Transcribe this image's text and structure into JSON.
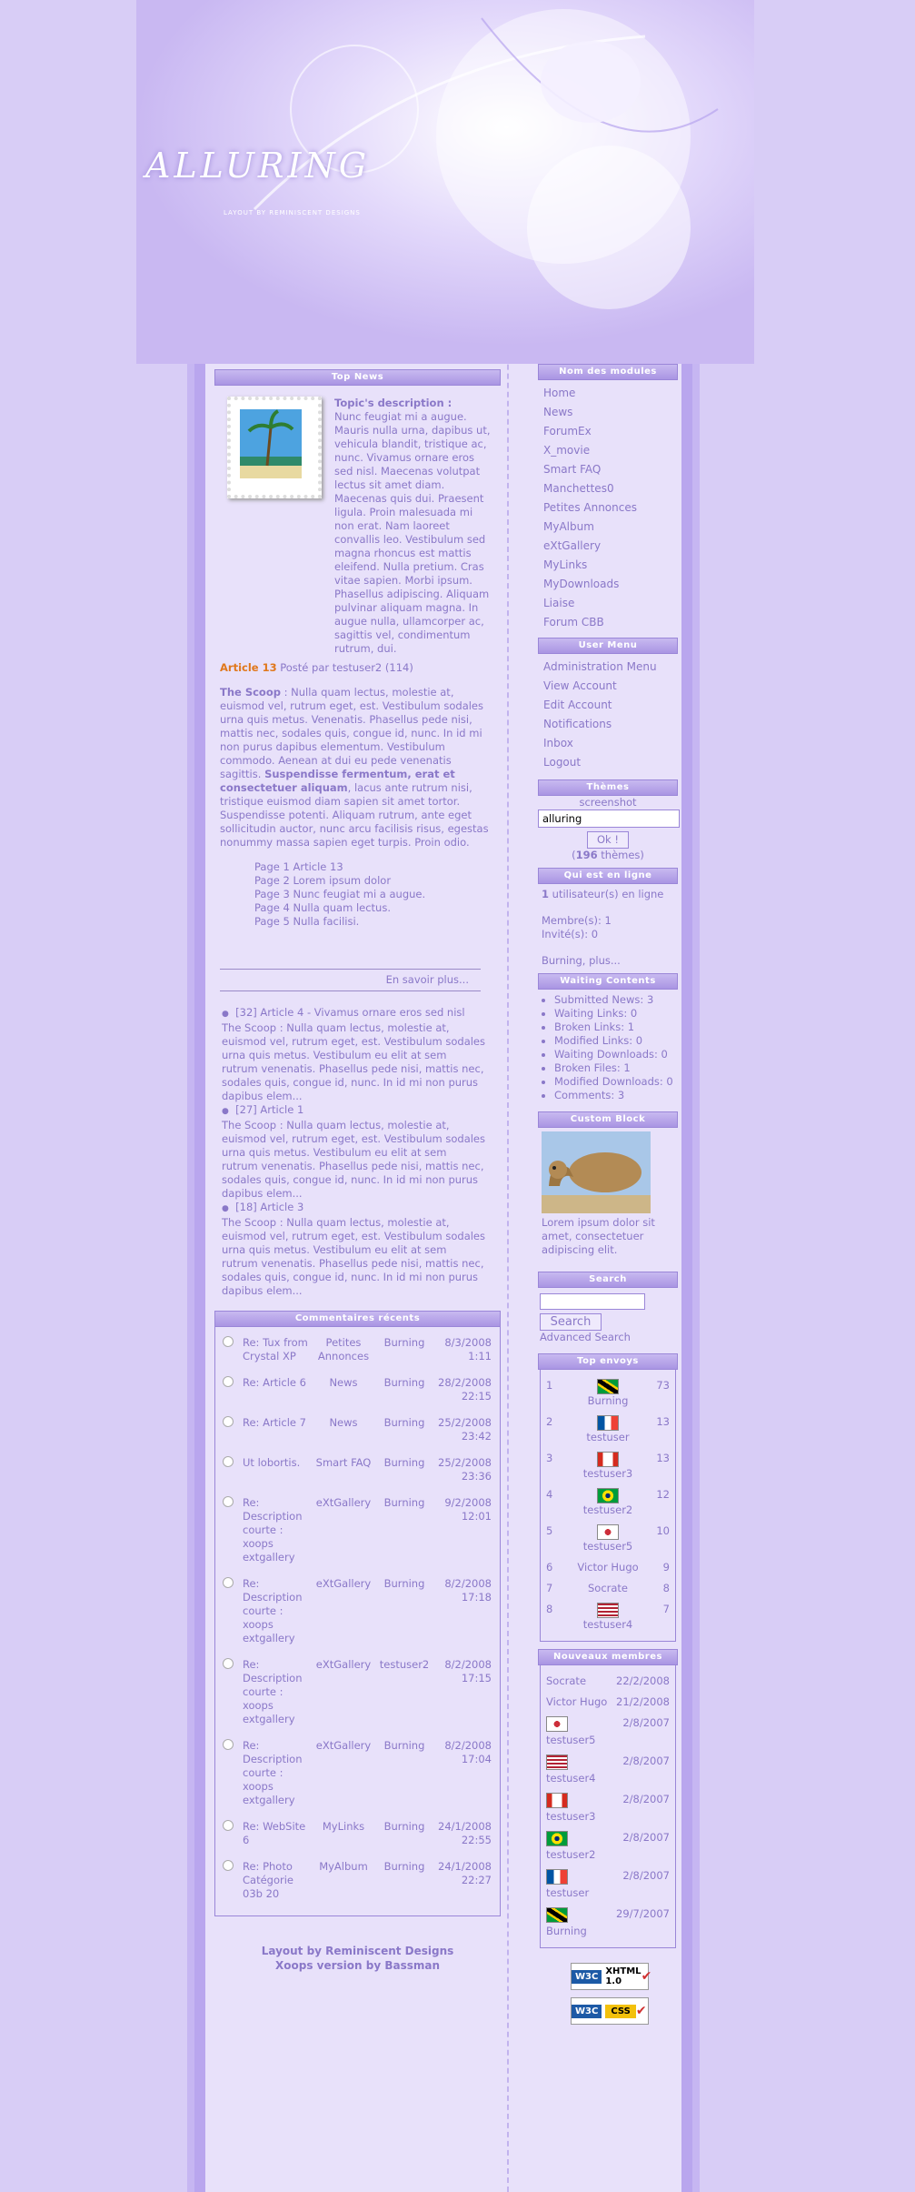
{
  "site": {
    "logo": "ALLURING",
    "logo_sub": "LAYOUT BY REMINISCENT DESIGNS"
  },
  "top_news": {
    "title": "Top News",
    "topic_label": "Topic's description :",
    "topic_text": "Nunc feugiat mi a augue. Mauris nulla urna, dapibus ut, vehicula blandit, tristique ac, nunc. Vivamus ornare eros sed nisl. Maecenas volutpat lectus sit amet diam. Maecenas quis dui. Praesent ligula. Proin malesuada mi non erat. Nam laoreet convallis leo. Vestibulum sed magna rhoncus est mattis eleifend. Nulla pretium. Cras vitae sapien. Morbi ipsum. Phasellus adipiscing. Aliquam pulvinar aliquam magna. In augue nulla, ullamcorper ac, sagittis vel, condimentum rutrum, dui.",
    "article_title": "Article 13",
    "article_meta": "Posté par testuser2 (114)",
    "scoop_label": "The Scoop",
    "scoop_text": " : Nulla quam lectus, molestie at, euismod vel, rutrum eget, est. Vestibulum sodales urna quis metus. Venenatis. Phasellus pede nisi, mattis nec, sodales quis, congue id, nunc. In id mi non purus dapibus elementum. Vestibulum commodo. Aenean at dui eu pede venenatis sagittis. ",
    "scoop_bold": "Suspendisse fermentum, erat et consectetuer aliquam",
    "scoop_text2": ", lacus ante rutrum nisi, tristique euismod diam sapien sit amet tortor. Suspendisse potenti. Aliquam rutrum, ante eget sollicitudin auctor, nunc arcu facilisis risus, egestas nonummy massa sapien eget turpis. Proin odio.",
    "pages": [
      "Page 1 Article 13",
      "Page 2 Lorem ipsum dolor",
      "Page 3 Nunc feugiat mi a augue.",
      "Page 4 Nulla quam lectus.",
      "Page 5 Nulla facilisi."
    ],
    "read_more": "En savoir plus...",
    "other_articles": [
      {
        "title": "[32] Article 4 - Vivamus ornare eros sed nisl",
        "text": "The Scoop : Nulla quam lectus, molestie at, euismod vel, rutrum eget, est. Vestibulum sodales urna quis metus. Vestibulum eu elit at sem rutrum venenatis. Phasellus pede nisi, mattis nec, sodales quis, congue id, nunc. In id mi non purus dapibus elem..."
      },
      {
        "title": "[27] Article 1",
        "text": "The Scoop : Nulla quam lectus, molestie at, euismod vel, rutrum eget, est. Vestibulum sodales urna quis metus. Vestibulum eu elit at sem rutrum venenatis. Phasellus pede nisi, mattis nec, sodales quis, congue id, nunc. In id mi non purus dapibus elem..."
      },
      {
        "title": "[18] Article 3",
        "text": "The Scoop : Nulla quam lectus, molestie at, euismod vel, rutrum eget, est. Vestibulum sodales urna quis metus. Vestibulum eu elit at sem rutrum venenatis. Phasellus pede nisi, mattis nec, sodales quis, congue id, nunc. In id mi non purus dapibus elem..."
      }
    ]
  },
  "recent_comments": {
    "title": "Commentaires récents",
    "rows": [
      {
        "title": "Re: Tux from Crystal XP",
        "module": "Petites Annonces",
        "user": "Burning",
        "date": "8/3/2008 1:11"
      },
      {
        "title": "Re: Article 6",
        "module": "News",
        "user": "Burning",
        "date": "28/2/2008 22:15"
      },
      {
        "title": "Re: Article 7",
        "module": "News",
        "user": "Burning",
        "date": "25/2/2008 23:42"
      },
      {
        "title": "Ut lobortis.",
        "module": "Smart FAQ",
        "user": "Burning",
        "date": "25/2/2008 23:36"
      },
      {
        "title": "Re: Description courte : xoops extgallery",
        "module": "eXtGallery",
        "user": "Burning",
        "date": "9/2/2008 12:01"
      },
      {
        "title": "Re: Description courte : xoops extgallery",
        "module": "eXtGallery",
        "user": "Burning",
        "date": "8/2/2008 17:18"
      },
      {
        "title": "Re: Description courte : xoops extgallery",
        "module": "eXtGallery",
        "user": "testuser2",
        "date": "8/2/2008 17:15"
      },
      {
        "title": "Re: Description courte : xoops extgallery",
        "module": "eXtGallery",
        "user": "Burning",
        "date": "8/2/2008 17:04"
      },
      {
        "title": "Re: WebSite 6",
        "module": "MyLinks",
        "user": "Burning",
        "date": "24/1/2008 22:55"
      },
      {
        "title": "Re: Photo Catégorie 03b 20",
        "module": "MyAlbum",
        "user": "Burning",
        "date": "24/1/2008 22:27"
      }
    ]
  },
  "footer": {
    "line1": "Layout by Reminiscent Designs",
    "line2": "Xoops version by Bassman"
  },
  "modules_menu": {
    "title": "Nom des modules",
    "items": [
      "Home",
      "News",
      "ForumEx",
      "X_movie",
      "Smart FAQ",
      "Manchettes0",
      "Petites Annonces",
      "MyAlbum",
      "eXtGallery",
      "MyLinks",
      "MyDownloads",
      "Liaise",
      "Forum CBB"
    ]
  },
  "user_menu": {
    "title": "User Menu",
    "items": [
      "Administration Menu",
      "View Account",
      "Edit Account",
      "Notifications",
      "Inbox",
      "Logout"
    ]
  },
  "themes": {
    "title": "Thèmes",
    "screenshot": "screenshot",
    "selected": "alluring",
    "button": "Ok !",
    "count_prefix": "(",
    "count": "196",
    "count_suffix": " thèmes)"
  },
  "online": {
    "title": "Qui est en ligne",
    "users_count": "1",
    "users_text": " utilisateur(s) en ligne",
    "members": "Membre(s): 1",
    "guests": "Invité(s): 0",
    "more": "Burning, plus..."
  },
  "waiting": {
    "title": "Waiting Contents",
    "items": [
      "Submitted News: 3",
      "Waiting Links: 0",
      "Broken Links: 1",
      "Modified Links: 0",
      "Waiting Downloads: 0",
      "Broken Files: 1",
      "Modified Downloads: 0",
      "Comments: 3"
    ]
  },
  "custom_block": {
    "title": "Custom Block",
    "text": "Lorem ipsum dolor sit amet, consectetuer adipiscing elit."
  },
  "search": {
    "title": "Search",
    "button": "Search",
    "advanced": "Advanced Search"
  },
  "top_posters": {
    "title": "Top envoys",
    "rows": [
      {
        "rank": "1",
        "user": "Burning",
        "count": "73",
        "flag": "jamaica"
      },
      {
        "rank": "2",
        "user": "testuser",
        "count": "13",
        "flag": "france"
      },
      {
        "rank": "3",
        "user": "testuser3",
        "count": "13",
        "flag": "canada"
      },
      {
        "rank": "4",
        "user": "testuser2",
        "count": "12",
        "flag": "brazil"
      },
      {
        "rank": "5",
        "user": "testuser5",
        "count": "10",
        "flag": "korea"
      },
      {
        "rank": "6",
        "user": "Victor Hugo",
        "count": "9",
        "flag": ""
      },
      {
        "rank": "7",
        "user": "Socrate",
        "count": "8",
        "flag": ""
      },
      {
        "rank": "8",
        "user": "testuser4",
        "count": "7",
        "flag": "usa"
      }
    ]
  },
  "new_members": {
    "title": "Nouveaux membres",
    "rows": [
      {
        "user": "Socrate",
        "date": "22/2/2008",
        "flag": ""
      },
      {
        "user": "Victor Hugo",
        "date": "21/2/2008",
        "flag": ""
      },
      {
        "user": "testuser5",
        "date": "2/8/2007",
        "flag": "korea"
      },
      {
        "user": "testuser4",
        "date": "2/8/2007",
        "flag": "usa"
      },
      {
        "user": "testuser3",
        "date": "2/8/2007",
        "flag": "canada"
      },
      {
        "user": "testuser2",
        "date": "2/8/2007",
        "flag": "brazil"
      },
      {
        "user": "testuser",
        "date": "2/8/2007",
        "flag": "france"
      },
      {
        "user": "Burning",
        "date": "29/7/2007",
        "flag": "jamaica"
      }
    ]
  },
  "badges": {
    "xhtml": "XHTML 1.0",
    "css": "CSS"
  }
}
